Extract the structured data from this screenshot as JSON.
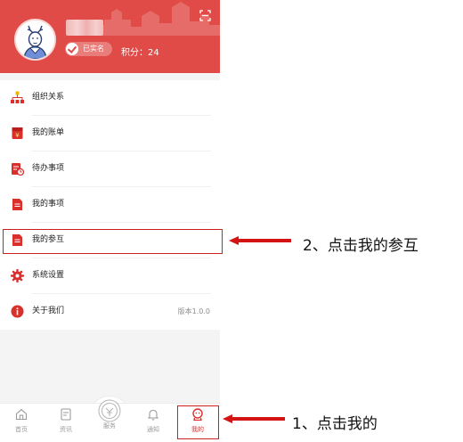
{
  "profile": {
    "verified_badge": "已实名",
    "points": "积分：24"
  },
  "menu": {
    "items": [
      {
        "label": "组织关系",
        "icon": "org-chart-icon"
      },
      {
        "label": "我的账单",
        "icon": "bill-icon"
      },
      {
        "label": "待办事项",
        "icon": "todo-icon"
      },
      {
        "label": "我的事项",
        "icon": "document-icon"
      },
      {
        "label": "我的参互",
        "icon": "participation-icon"
      },
      {
        "label": "系统设置",
        "icon": "gear-icon"
      },
      {
        "label": "关于我们",
        "icon": "info-icon"
      }
    ],
    "version": "版本1.0.0"
  },
  "tabbar": {
    "tabs": [
      {
        "label": "首页",
        "icon": "home-icon"
      },
      {
        "label": "资讯",
        "icon": "news-icon"
      },
      {
        "label": "服务",
        "icon": "service-icon"
      },
      {
        "label": "通知",
        "icon": "bell-icon"
      },
      {
        "label": "我的",
        "icon": "user-icon"
      }
    ]
  },
  "annotations": {
    "step1": "1、点击我的",
    "step2": "2、点击我的参互"
  },
  "colors": {
    "brand_red": "#e04b47",
    "annotation_red": "#cc1f1f",
    "active_tab": "#d9302c"
  }
}
